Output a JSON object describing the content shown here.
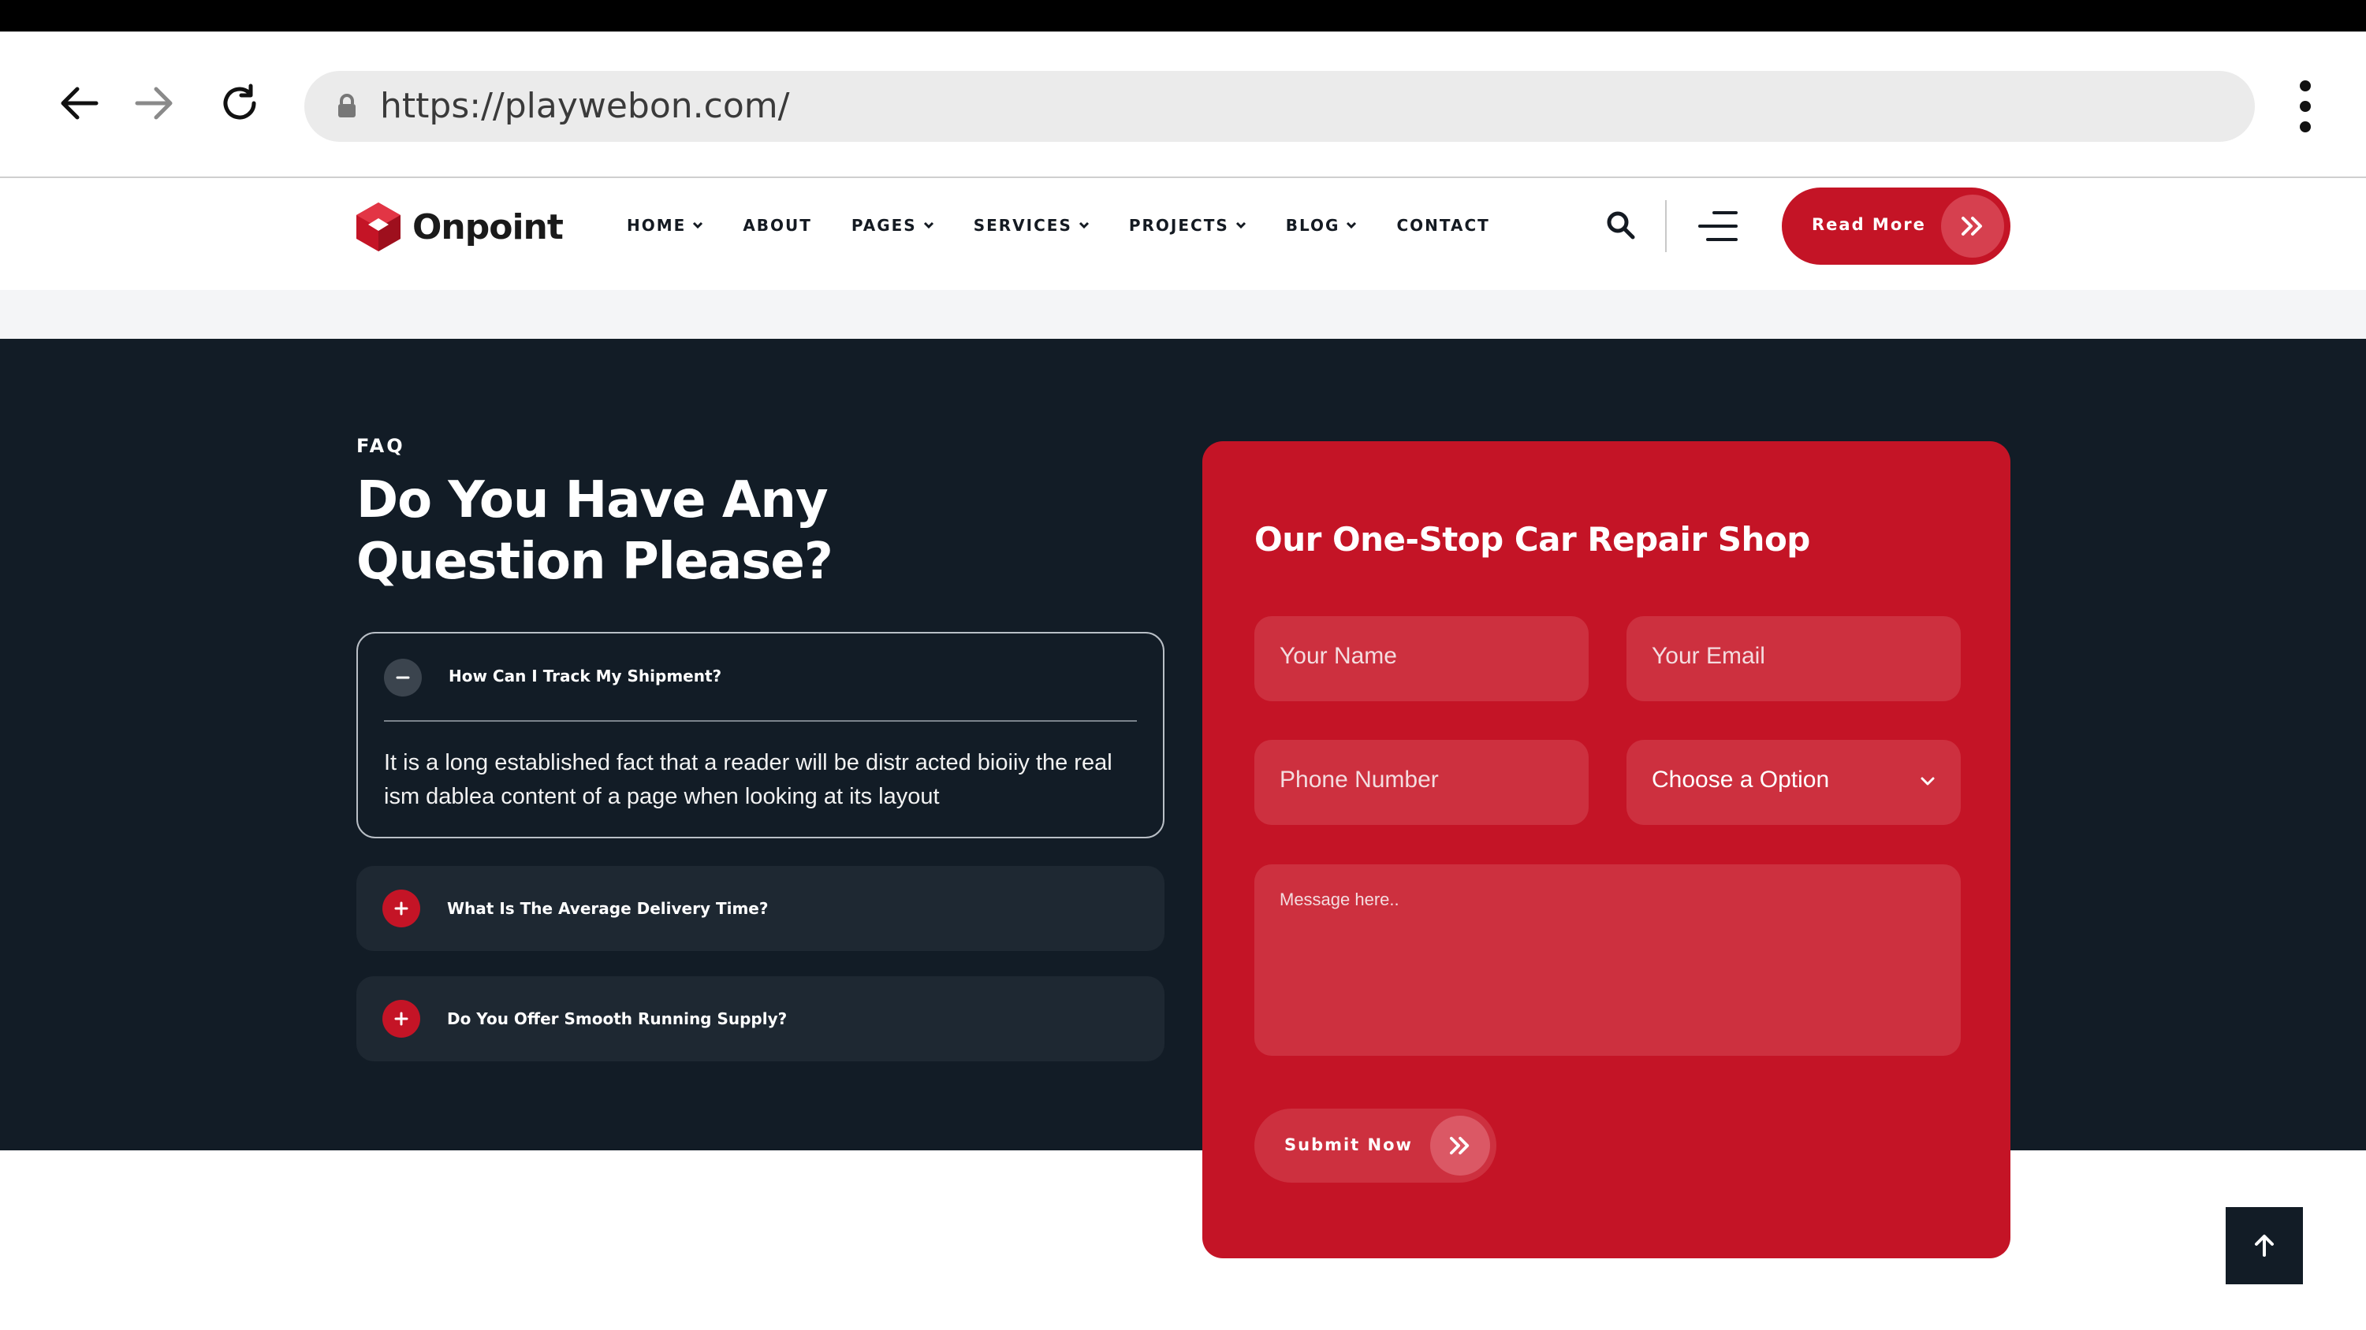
{
  "browser": {
    "url": "https://playwebon.com/",
    "icons": [
      "back-arrow-icon",
      "forward-arrow-icon",
      "reload-icon",
      "lock-icon",
      "kebab-menu-icon"
    ]
  },
  "header": {
    "logo_text": "Onpoint",
    "nav": [
      {
        "label": "HOME",
        "has_dropdown": true
      },
      {
        "label": "ABOUT",
        "has_dropdown": false
      },
      {
        "label": "PAGES",
        "has_dropdown": true
      },
      {
        "label": "SERVICES",
        "has_dropdown": true
      },
      {
        "label": "PROJECTS",
        "has_dropdown": true
      },
      {
        "label": "BLOG",
        "has_dropdown": true
      },
      {
        "label": "CONTACT",
        "has_dropdown": false
      }
    ],
    "cta_label": "Read More",
    "icons": [
      "search-icon",
      "hamburger-menu-icon",
      "double-chevron-right-icon"
    ]
  },
  "faq": {
    "eyebrow": "FAQ",
    "title": "Do You Have Any Question Please?",
    "items": [
      {
        "question": "How Can I Track My Shipment?",
        "answer": "It is a long established fact that a reader will be distr acted bioiiy the real ism dablea content of a page when looking at its layout",
        "expanded": true
      },
      {
        "question": "What Is The Average Delivery Time?",
        "expanded": false
      },
      {
        "question": "Do You Offer Smooth Running Supply?",
        "expanded": false
      }
    ]
  },
  "contact_form": {
    "title": "Our One-Stop Car Repair Shop",
    "name_placeholder": "Your Name",
    "email_placeholder": "Your Email",
    "phone_placeholder": "Phone Number",
    "select_value": "Choose a Option",
    "message_placeholder": "Message here..",
    "submit_label": "Submit Now"
  },
  "colors": {
    "brand_red": "#c41426",
    "dark_navy": "#121c26",
    "field_red": "#cd303f"
  }
}
